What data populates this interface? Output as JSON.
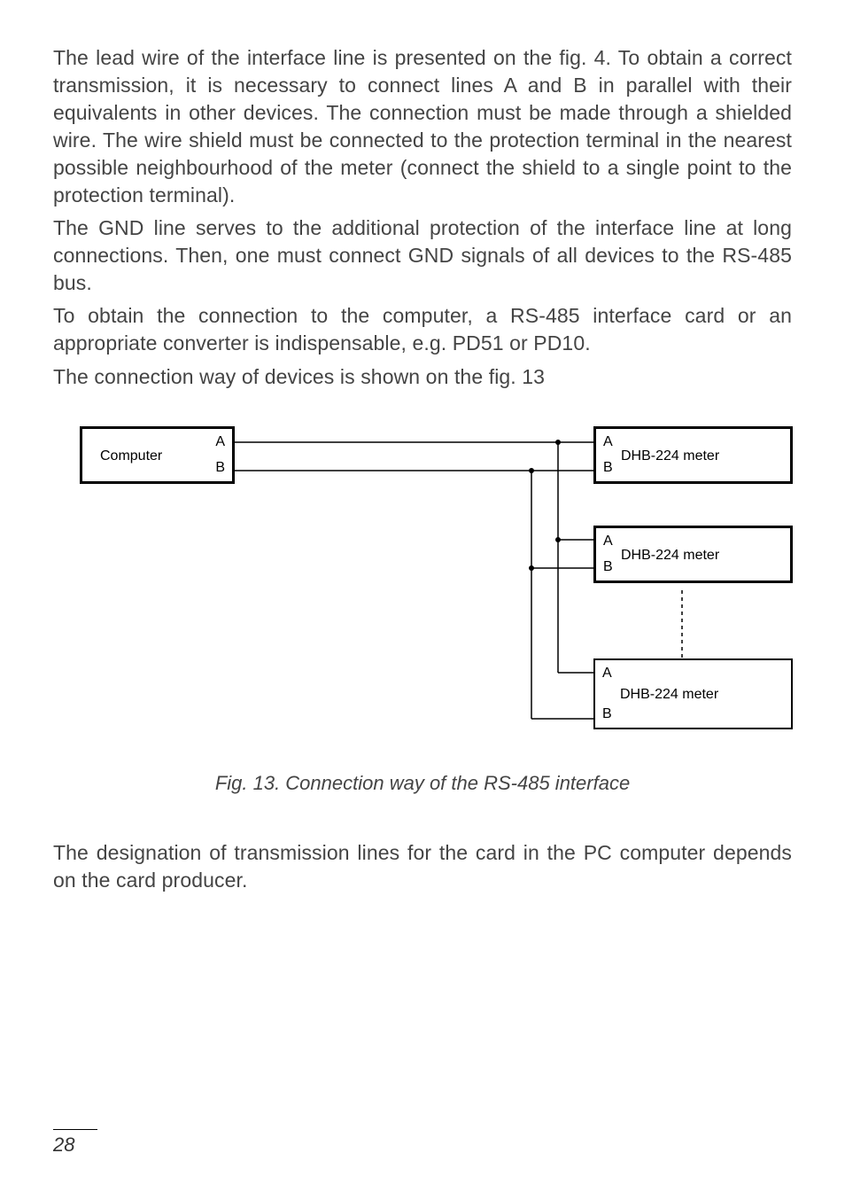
{
  "paragraphs": {
    "p1": "The lead wire of the interface line is presented on the fig. 4. To obtain a correct transmission, it is necessary to connect lines A and B in parallel with their equivalents in other devices. The connection must be made through a shielded wire. The wire shield must be connected to the pro­tection terminal in the nearest possible neighbourhood of the meter (connect the shield to a single point to the protection terminal).",
    "p2": "The GND line serves to the additional protection of the interface line at long connections. Then, one must connect GND signals of all devices to the RS-485 bus.",
    "p3": "To obtain the connection to the computer, a RS-485 interface card  or an appropriate converter is indispensable, e.g. PD51 or PD10.",
    "p4": "The connection way of devices is shown on the fig. 13"
  },
  "diagram": {
    "computer_label": "Computer",
    "meter_label_1": "DHB-224 meter",
    "meter_label_2": "DHB-224 meter",
    "meter_label_3": "DHB-224 meter",
    "pinA": "A",
    "pinB": "B"
  },
  "chart_data": {
    "type": "diagram",
    "title": "Connection way of the RS-485 interface",
    "nodes": [
      {
        "id": "computer",
        "label": "Computer",
        "pins": [
          "A",
          "B"
        ]
      },
      {
        "id": "meter1",
        "label": "DHB-224 meter",
        "pins": [
          "A",
          "B"
        ]
      },
      {
        "id": "meter2",
        "label": "DHB-224 meter",
        "pins": [
          "A",
          "B"
        ]
      },
      {
        "id": "meter3",
        "label": "DHB-224 meter",
        "pins": [
          "A",
          "B"
        ]
      }
    ],
    "connections": [
      {
        "from": "computer.A",
        "to": "meter1.A",
        "bus": "A"
      },
      {
        "from": "computer.B",
        "to": "meter1.B",
        "bus": "B"
      },
      {
        "from": "bus.A",
        "to": "meter2.A",
        "bus": "A"
      },
      {
        "from": "bus.B",
        "to": "meter2.B",
        "bus": "B"
      },
      {
        "from": "bus.A",
        "to": "meter3.A",
        "bus": "A"
      },
      {
        "from": "bus.B",
        "to": "meter3.B",
        "bus": "B"
      }
    ],
    "note": "Dashed line between meter2 and meter3 indicates additional meters may be chained"
  },
  "caption": "Fig. 13.  Connection way of the RS-485 interface",
  "closing": "The designation of transmission lines for the card in the PC computer depends on the card producer.",
  "page_number": "28"
}
